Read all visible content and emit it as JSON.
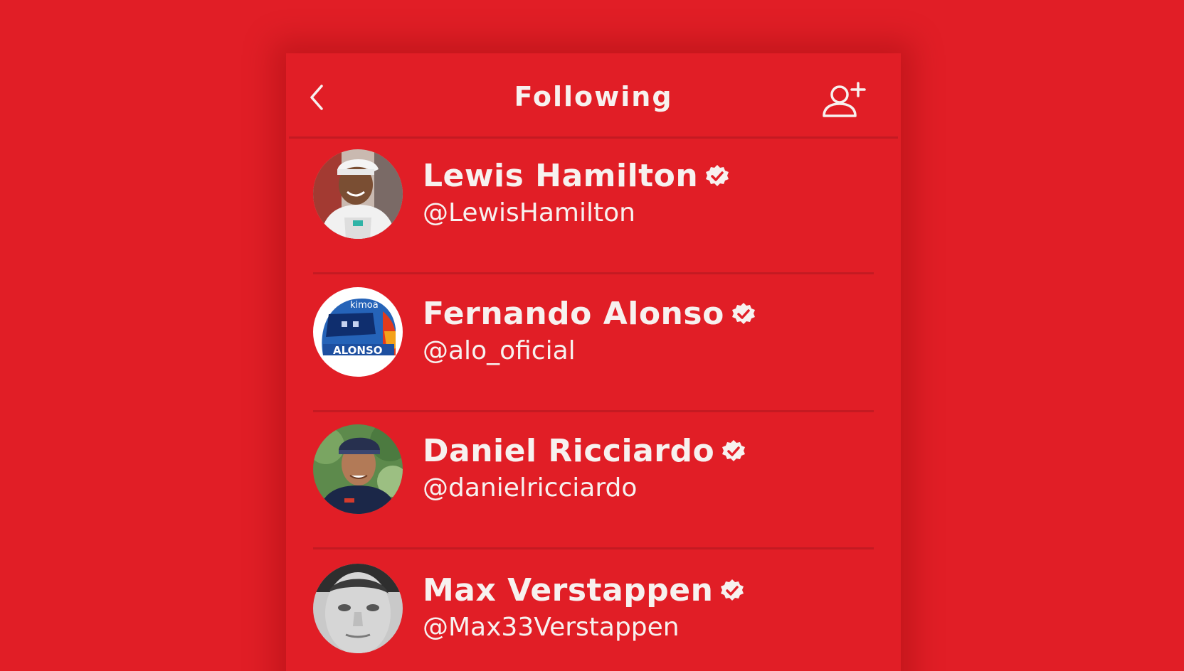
{
  "header": {
    "title": "Following",
    "back_icon": "chevron-left-icon",
    "add_icon": "add-user-icon"
  },
  "theme": {
    "background": "#e11e26",
    "text": "#f7f1ef",
    "divider": "#c41a22"
  },
  "following": [
    {
      "name": "Lewis Hamilton",
      "handle": "@LewisHamilton",
      "verified": true
    },
    {
      "name": "Fernando Alonso",
      "handle": "@alo_oficial",
      "verified": true,
      "avatar_text": "kimoa",
      "avatar_helmet_text": "ALONSO"
    },
    {
      "name": "Daniel Ricciardo",
      "handle": "@danielricciardo",
      "verified": true
    },
    {
      "name": "Max Verstappen",
      "handle": "@Max33Verstappen",
      "verified": true
    }
  ]
}
